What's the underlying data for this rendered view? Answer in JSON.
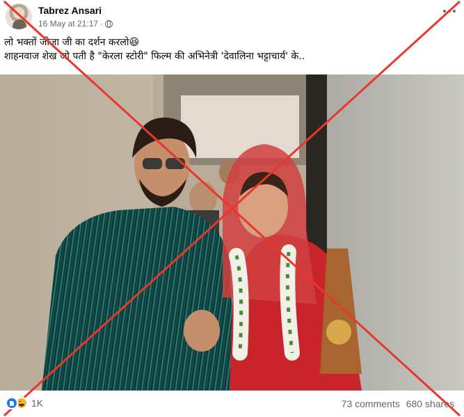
{
  "post": {
    "author": "Tabrez Ansari",
    "timestamp": "16 May at 21:17",
    "separator": "·",
    "text_line1": "लो भक्तों जीजा जी का दर्शन करलो😆",
    "text_line2": "शाहनवाज शेख जो पती है \"केरला स्टोरी\" फिल्म की अभिनेत्री 'देवालिना भट्टाचार्य' के..",
    "photo_icon": "wedding-photo"
  },
  "footer": {
    "reaction_count": "1K",
    "comments": "73 comments",
    "shares": "680 shares"
  },
  "colors": {
    "cross": "#e8372d",
    "like": "#1877f2",
    "haha": "#f7b928",
    "muted_text": "#65676b"
  }
}
